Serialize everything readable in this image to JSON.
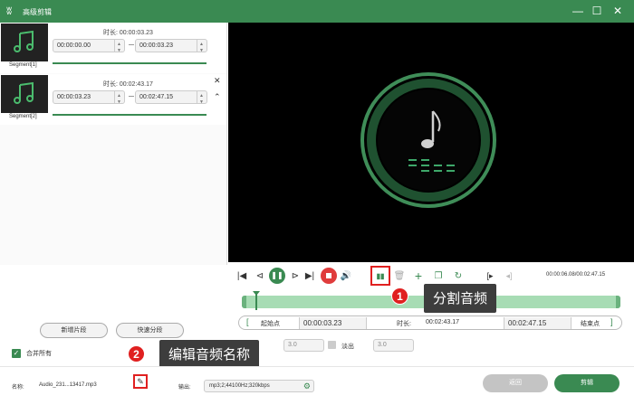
{
  "app": {
    "title": "高级剪辑",
    "logo": "ʬ"
  },
  "window": {
    "minimize": "—",
    "maximize": "☐",
    "close": "✕"
  },
  "segments": [
    {
      "label": "Segment[1]",
      "duration": "时长: 00:00:03.23",
      "start": "00:00:00.00",
      "end": "00:00:03.23"
    },
    {
      "label": "Segment[2]",
      "duration": "时长: 00:02:43.17",
      "start": "00:00:03.23",
      "end": "00:02:47.15"
    }
  ],
  "buttons": {
    "new_segment": "新增片段",
    "quick_split": "快速分段",
    "back": "返回",
    "edit": "剪辑"
  },
  "merge_all": {
    "label": "合并所有",
    "checked": "✓"
  },
  "playback": {
    "time": "00:00:06.08/00:02:47.15"
  },
  "range": {
    "start_label": "起始点",
    "start_value": "00:00:03.23",
    "duration_label": "时长:",
    "duration_value": "00:02:43.17",
    "end_value": "00:02:47.15",
    "end_label": "结束点"
  },
  "fade": {
    "in_value": "3.0",
    "out_label": "淡出",
    "out_value": "3.0"
  },
  "callouts": [
    {
      "number": "1",
      "text": "分割音频"
    },
    {
      "number": "2",
      "text": "编辑音频名称"
    }
  ],
  "bottom": {
    "name_label": "名称:",
    "name_value": "Audio_231...13417.mp3",
    "output_label": "输出:",
    "output_value": "mp3;2;44100Hz;320kbps"
  },
  "colors": {
    "accent": "#3a8a52",
    "highlight": "#e02020",
    "callout_bg": "#3d3d3d"
  }
}
